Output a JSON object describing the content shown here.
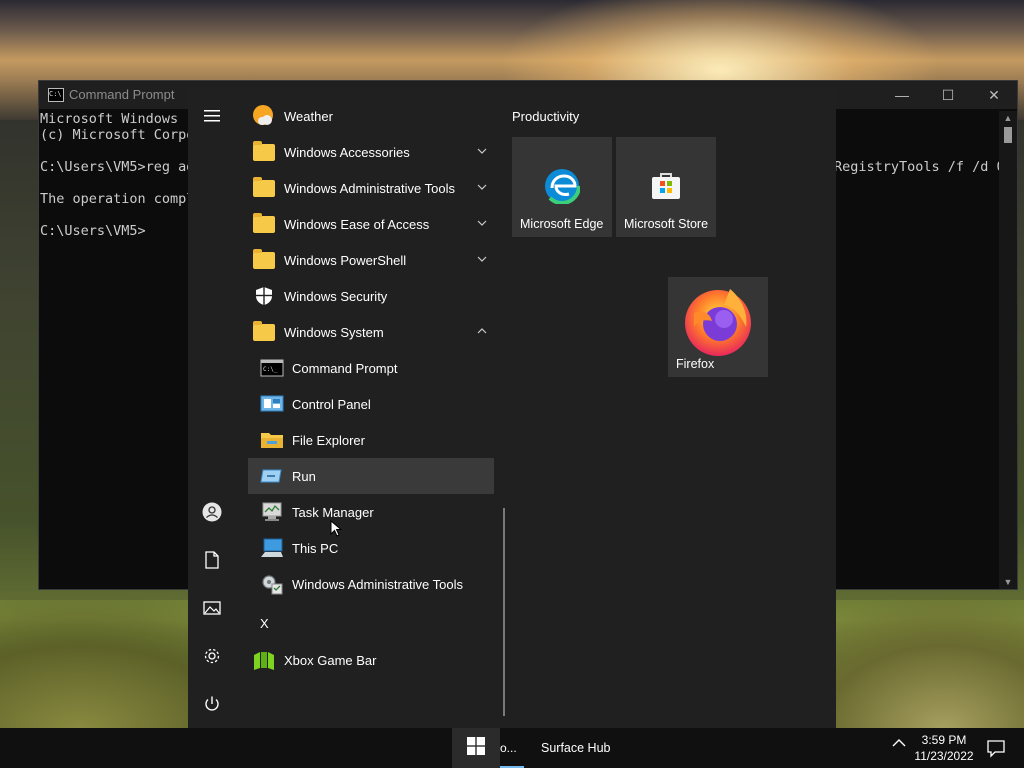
{
  "command_prompt": {
    "title": "Command Prompt",
    "lines": [
      "Microsoft Windows [",
      "(c) Microsoft Corpo",
      "",
      "C:\\Users\\VM5>reg ad",
      "",
      "The operation compl",
      "",
      "C:\\Users\\VM5>"
    ],
    "line_right": "RegistryTools /f /d 0",
    "controls": {
      "minimize": "—",
      "maximize": "☐",
      "close": "✕"
    }
  },
  "start_menu": {
    "rail": {
      "menu_icon": "hamburger-icon",
      "account_icon": "user-icon",
      "documents_icon": "document-icon",
      "pictures_icon": "image-icon",
      "settings_icon": "gear-icon",
      "power_icon": "power-icon"
    },
    "apps": [
      {
        "label": "Weather",
        "icon": "weather-icon"
      },
      {
        "label": "Windows Accessories",
        "icon": "folder-icon",
        "expand": "collapsed"
      },
      {
        "label": "Windows Administrative Tools",
        "icon": "folder-icon",
        "expand": "collapsed"
      },
      {
        "label": "Windows Ease of Access",
        "icon": "folder-icon",
        "expand": "collapsed"
      },
      {
        "label": "Windows PowerShell",
        "icon": "folder-icon",
        "expand": "collapsed"
      },
      {
        "label": "Windows Security",
        "icon": "shield-icon"
      },
      {
        "label": "Windows System",
        "icon": "folder-icon",
        "expand": "expanded"
      },
      {
        "label": "Command Prompt",
        "icon": "command-prompt-icon"
      },
      {
        "label": "Control Panel",
        "icon": "control-panel-icon"
      },
      {
        "label": "File Explorer",
        "icon": "file-explorer-icon"
      },
      {
        "label": "Run",
        "icon": "run-icon"
      },
      {
        "label": "Task Manager",
        "icon": "task-manager-icon"
      },
      {
        "label": "This PC",
        "icon": "this-pc-icon"
      },
      {
        "label": "Windows Administrative Tools",
        "icon": "admin-tools-icon"
      }
    ],
    "letter_x": "X",
    "xbox": {
      "label": "Xbox Game Bar",
      "icon": "xbox-game-bar-icon"
    },
    "group_title": "Productivity",
    "tiles": [
      {
        "label": "Microsoft Edge",
        "icon": "edge-icon"
      },
      {
        "label": "Microsoft Store",
        "icon": "store-icon"
      },
      {
        "label": "Firefox",
        "icon": "firefox-icon"
      }
    ]
  },
  "taskbar": {
    "start_icon": "windows-logo-icon",
    "app1_label": "o...",
    "app2_label": "Surface Hub",
    "tray_chevron": "^",
    "time": "3:59 PM",
    "date": "11/23/2022",
    "notification_icon": "notification-icon"
  },
  "colors": {
    "start_bg": "#202020",
    "tile_bg": "#353535",
    "highlight": "#3a3a3a",
    "folder": "#f7c948",
    "taskbar": "#101010",
    "accent_indicator": "#76b9ed"
  }
}
